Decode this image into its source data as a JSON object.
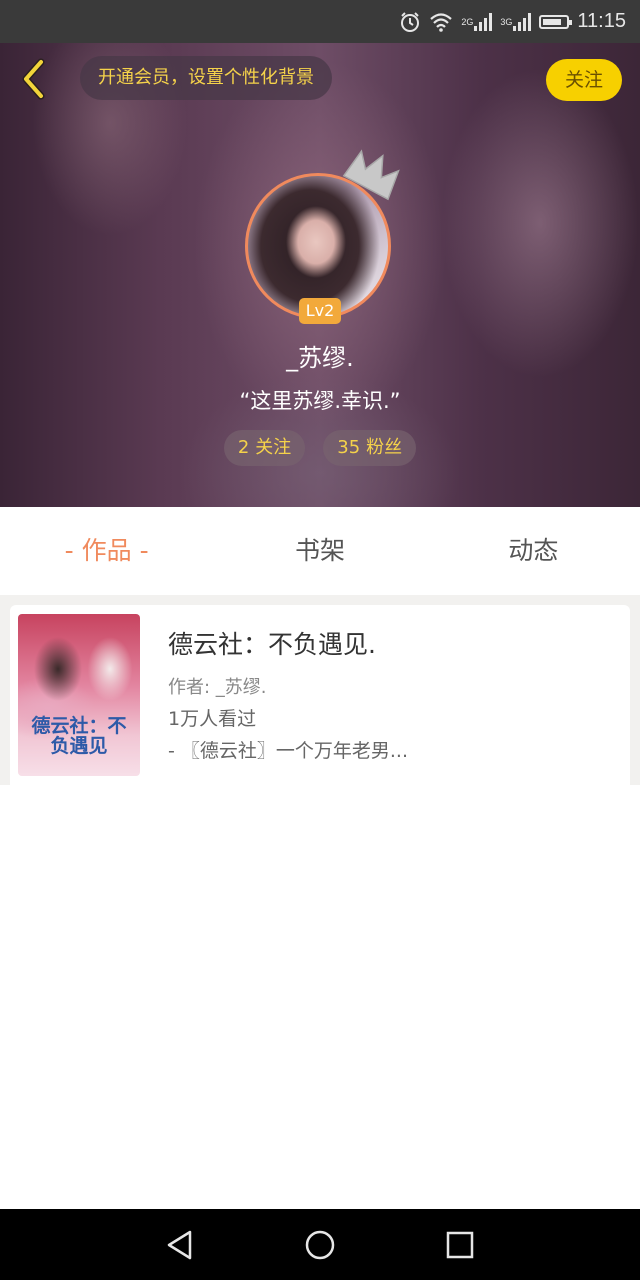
{
  "status_bar": {
    "time": "11:15",
    "signal1_label": "2G",
    "signal2_label": "3G",
    "icons": [
      "alarm-icon",
      "wifi-icon",
      "signal-icon",
      "signal-icon",
      "battery-icon"
    ]
  },
  "header": {
    "vip_banner": "开通会员，设置个性化背景",
    "follow_label": "关注",
    "back_icon": "chevron-left-icon"
  },
  "profile": {
    "level": "Lv2",
    "username": "_苏缪.",
    "signature": "“这里苏缪.幸识.”",
    "following_count": "2",
    "following_label": "关注",
    "followers_count": "35",
    "followers_label": "粉丝"
  },
  "tabs": [
    {
      "label": "作品",
      "active": true
    },
    {
      "label": "书架",
      "active": false
    },
    {
      "label": "动态",
      "active": false
    }
  ],
  "works": [
    {
      "title": "德云社：不负遇见.",
      "author": "作者: _苏缪.",
      "views": "1万人看过",
      "description": "- 〖德云社〗一个万年老男...",
      "cover_text": "德云社：不负遇见"
    }
  ],
  "colors": {
    "accent": "#f08a5d",
    "follow_button": "#f7d000",
    "banner_text": "#f5d24a"
  }
}
